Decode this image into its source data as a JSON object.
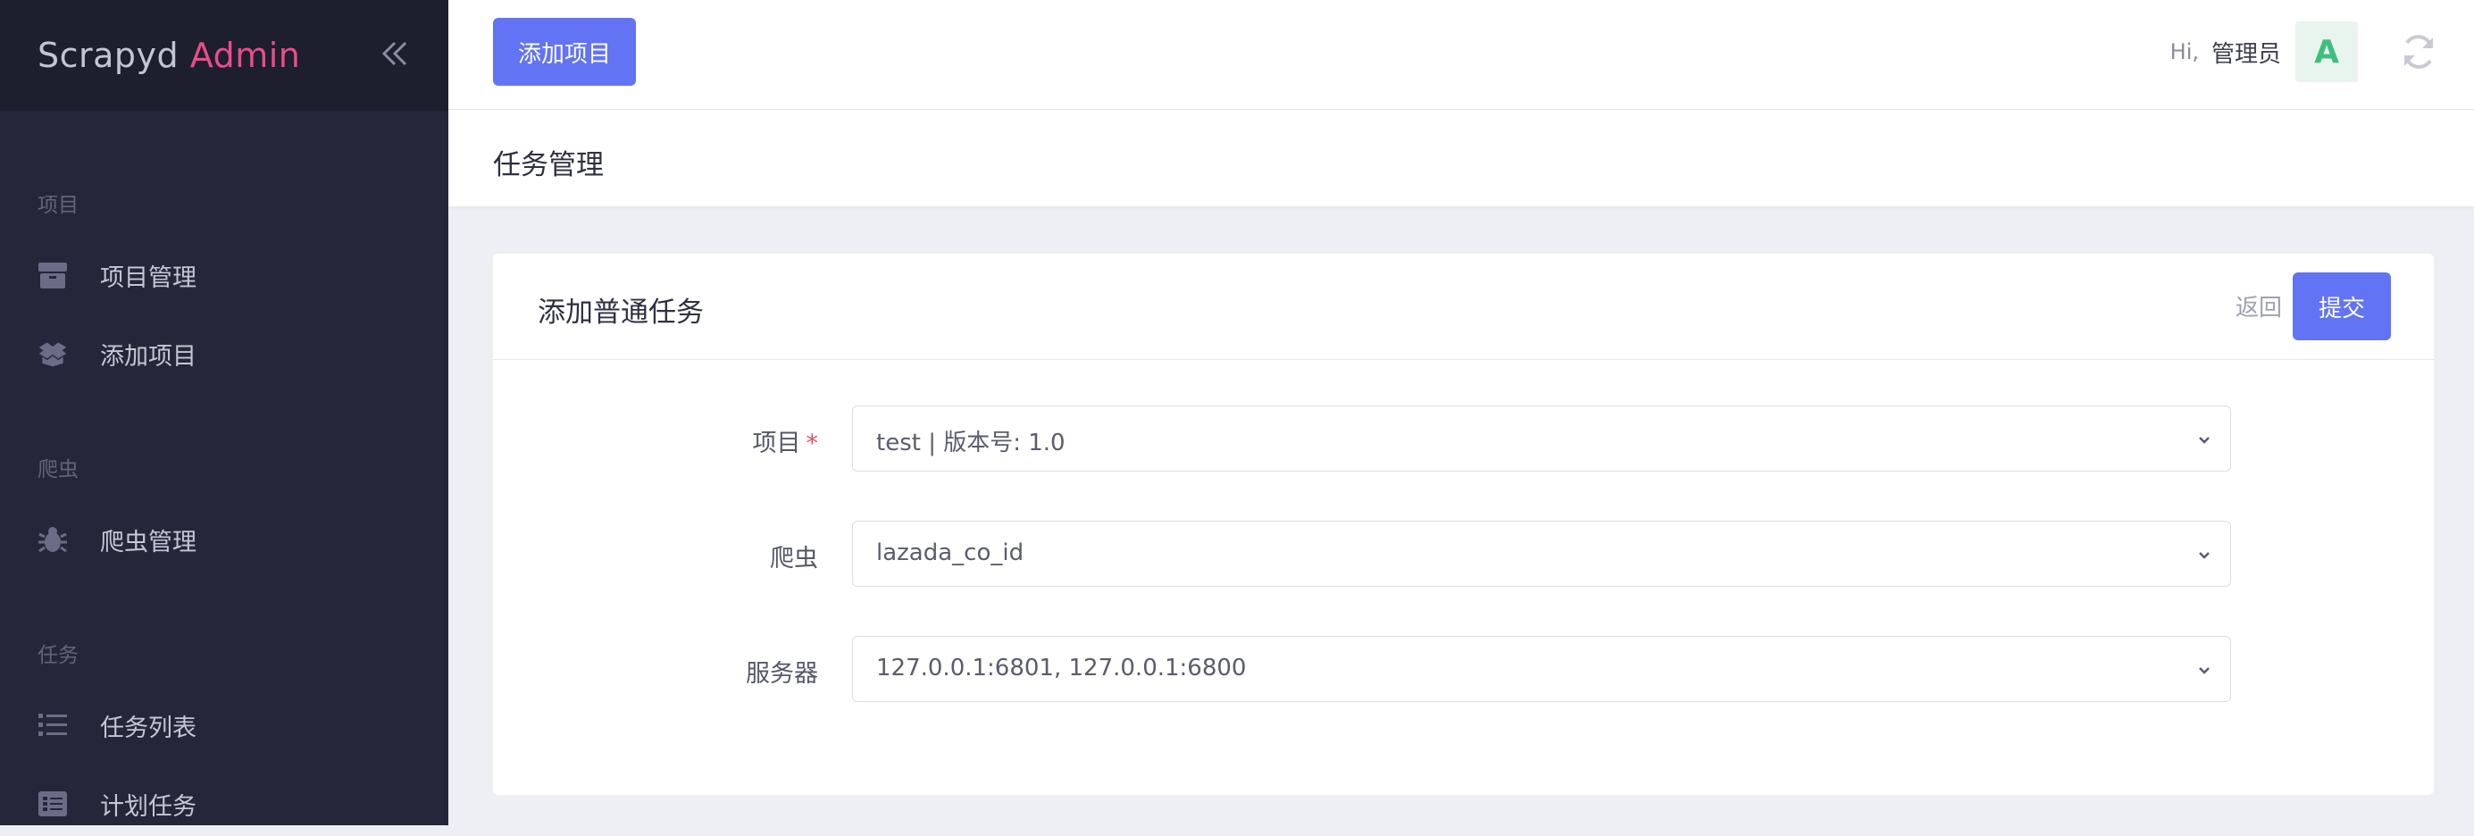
{
  "brand": {
    "name": "Scrapyd",
    "accent": "Admin"
  },
  "sidebar": {
    "sections": [
      {
        "label": "项目",
        "items": [
          {
            "label": "项目管理",
            "icon": "box-icon"
          },
          {
            "label": "添加项目",
            "icon": "open-box-icon"
          }
        ]
      },
      {
        "label": "爬虫",
        "items": [
          {
            "label": "爬虫管理",
            "icon": "bug-icon"
          }
        ]
      },
      {
        "label": "任务",
        "items": [
          {
            "label": "任务列表",
            "icon": "list-icon"
          },
          {
            "label": "计划任务",
            "icon": "schedule-icon"
          }
        ]
      }
    ]
  },
  "topbar": {
    "add_project": "添加项目",
    "greeting": "Hi,",
    "username": "管理员",
    "avatar_letter": "A"
  },
  "page": {
    "title": "任务管理"
  },
  "card": {
    "title": "添加普通任务",
    "back_label": "返回",
    "submit_label": "提交",
    "fields": [
      {
        "label": "项目",
        "required": true,
        "value": "test | 版本号: 1.0"
      },
      {
        "label": "爬虫",
        "required": false,
        "value": "lazada_co_id"
      },
      {
        "label": "服务器",
        "required": false,
        "value": "127.0.0.1:6801, 127.0.0.1:6800"
      }
    ]
  },
  "colors": {
    "sidebar": "#25263a",
    "primary": "#6273f4",
    "accent": "#ea4c89"
  }
}
